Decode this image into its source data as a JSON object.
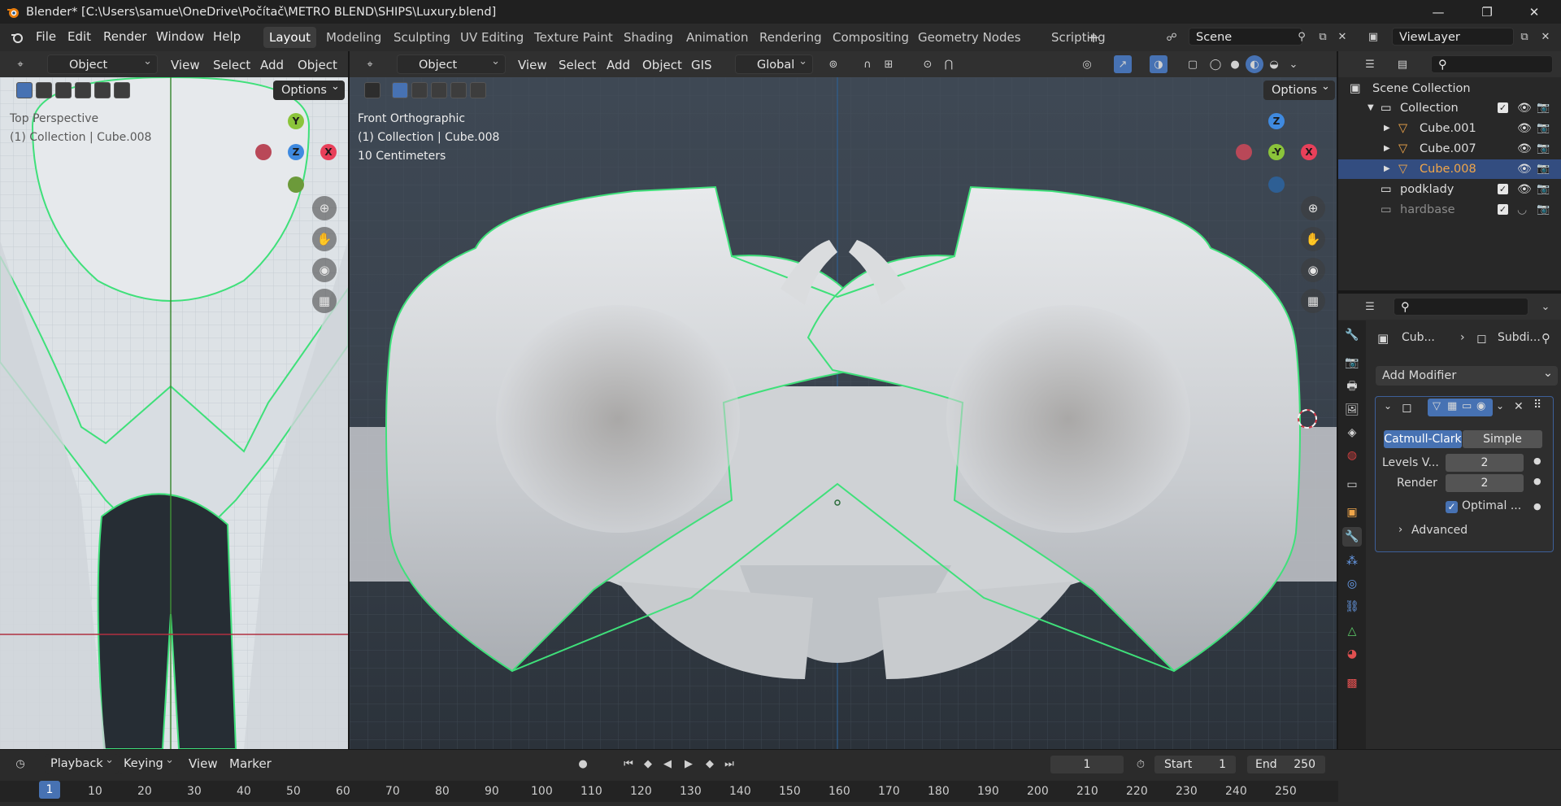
{
  "window": {
    "title": "Blender* [C:\\Users\\samue\\OneDrive\\Počítač\\METRO BLEND\\SHIPS\\Luxury.blend]",
    "controls": [
      "—",
      "❐",
      "✕"
    ]
  },
  "menu": [
    "File",
    "Edit",
    "Render",
    "Window",
    "Help"
  ],
  "workspaces": [
    "Layout",
    "Modeling",
    "Sculpting",
    "UV Editing",
    "Texture Paint",
    "Shading",
    "Animation",
    "Rendering",
    "Compositing",
    "Geometry Nodes",
    "Scripting"
  ],
  "active_workspace": "Layout",
  "scene_field": "Scene",
  "view_layer_field": "ViewLayer",
  "left_view": {
    "mode": "Object Mode",
    "menus": [
      "View",
      "Select",
      "Add",
      "Object"
    ],
    "options": "Options",
    "title": "Top Perspective",
    "collection_info": "(1) Collection | Cube.008",
    "gizmo": {
      "y": "Y",
      "z": "Z",
      "x": "X"
    }
  },
  "main_view": {
    "mode": "Object Mode",
    "menus": [
      "View",
      "Select",
      "Add",
      "Object",
      "GIS"
    ],
    "orientation": "Global",
    "options": "Options",
    "title": "Front Orthographic",
    "collection_info": "(1) Collection | Cube.008",
    "grid_scale": "10 Centimeters",
    "gizmo": {
      "z": "Z",
      "y": "-Y",
      "x": "X"
    }
  },
  "outliner": {
    "root": "Scene Collection",
    "items": [
      {
        "name": "Collection",
        "level": 1,
        "icon": "collection-icon"
      },
      {
        "name": "Cube.001",
        "level": 2,
        "icon": "mesh-icon"
      },
      {
        "name": "Cube.007",
        "level": 2,
        "icon": "mesh-icon"
      },
      {
        "name": "Cube.008",
        "level": 2,
        "icon": "mesh-icon",
        "selected": true
      },
      {
        "name": "podklady",
        "level": 1,
        "icon": "collection-icon"
      },
      {
        "name": "hardbase",
        "level": 1,
        "icon": "collection-icon",
        "hidden": true
      }
    ]
  },
  "properties": {
    "breadcrumb_object": "Cub...",
    "breadcrumb_modifier": "Subdi...",
    "add_modifier": "Add Modifier",
    "modifier": {
      "type_a": "Catmull-Clark",
      "type_b": "Simple",
      "levels_label": "Levels V...",
      "levels_value": "2",
      "render_label": "Render",
      "render_value": "2",
      "optimal_label": "Optimal ...",
      "advanced_label": "Advanced"
    }
  },
  "timeline": {
    "menus": [
      "Playback",
      "Keying",
      "View",
      "Marker"
    ],
    "current_frame": "1",
    "start_label": "Start",
    "start_value": "1",
    "end_label": "End",
    "end_value": "250",
    "ruler": [
      "1",
      "10",
      "20",
      "30",
      "40",
      "50",
      "60",
      "70",
      "80",
      "90",
      "100",
      "110",
      "120",
      "130",
      "140",
      "150",
      "160",
      "170",
      "180",
      "190",
      "200",
      "210",
      "220",
      "230",
      "240",
      "250"
    ]
  },
  "colors": {
    "accent_blue": "#4772b3",
    "selection_outline": "#3fe07a",
    "axis_x": "#e8405a",
    "axis_y": "#8bc43a",
    "axis_z": "#3f8ae0",
    "selected_object": "#f0a64a"
  }
}
